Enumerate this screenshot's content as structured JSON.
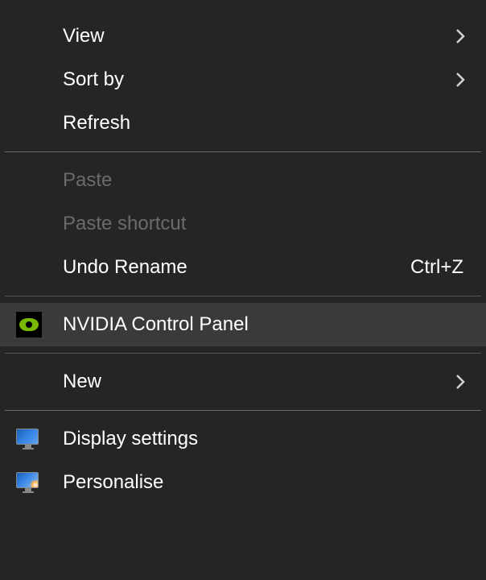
{
  "menu": {
    "view": {
      "label": "View",
      "has_submenu": true
    },
    "sort_by": {
      "label": "Sort by",
      "has_submenu": true
    },
    "refresh": {
      "label": "Refresh"
    },
    "paste": {
      "label": "Paste",
      "disabled": true
    },
    "paste_shortcut": {
      "label": "Paste shortcut",
      "disabled": true
    },
    "undo_rename": {
      "label": "Undo Rename",
      "shortcut": "Ctrl+Z"
    },
    "nvidia": {
      "label": "NVIDIA Control Panel",
      "highlighted": true
    },
    "new": {
      "label": "New",
      "has_submenu": true
    },
    "display_settings": {
      "label": "Display settings"
    },
    "personalise": {
      "label": "Personalise"
    }
  }
}
